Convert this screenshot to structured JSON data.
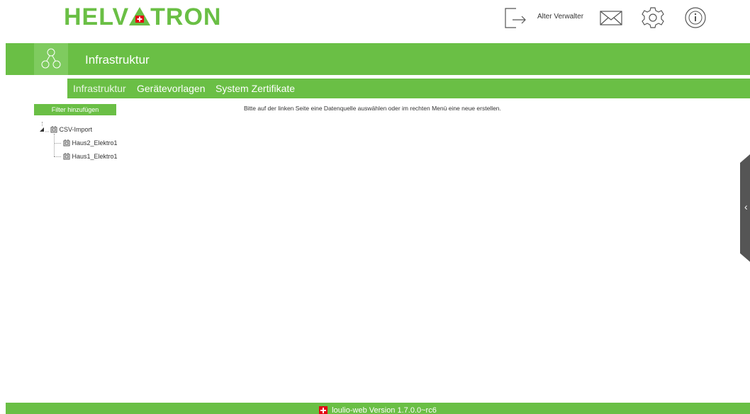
{
  "brand": {
    "logo_left": "HELV",
    "logo_right": "TRON"
  },
  "header": {
    "user_name": "Alter Verwalter",
    "icons": [
      "logout-icon",
      "mail-icon",
      "gear-icon",
      "info-icon"
    ]
  },
  "titlebar": {
    "icon": "infrastructure-icon",
    "title": "Infrastruktur"
  },
  "nav": {
    "tabs": [
      {
        "label": "Infrastruktur",
        "active": true
      },
      {
        "label": "Gerätevorlagen",
        "active": false
      },
      {
        "label": "System Zertifikate",
        "active": false
      }
    ]
  },
  "filter": {
    "button_label": "Filter hinzufügen"
  },
  "main": {
    "message": "Bitte auf der linken Seite eine Datenquelle auswählen oder im rechten Menü eine neue erstellen."
  },
  "tree": {
    "root": {
      "label": "CSV-Import",
      "expanded": true
    },
    "children": [
      {
        "label": "Haus2_Elektro1"
      },
      {
        "label": "Haus1_Elektro1"
      }
    ]
  },
  "footer": {
    "version_text": "loulio-web Version 1.7.0.0~rc6"
  },
  "colors": {
    "brand_green": "#6abf45",
    "swiss_red": "#e30613"
  }
}
